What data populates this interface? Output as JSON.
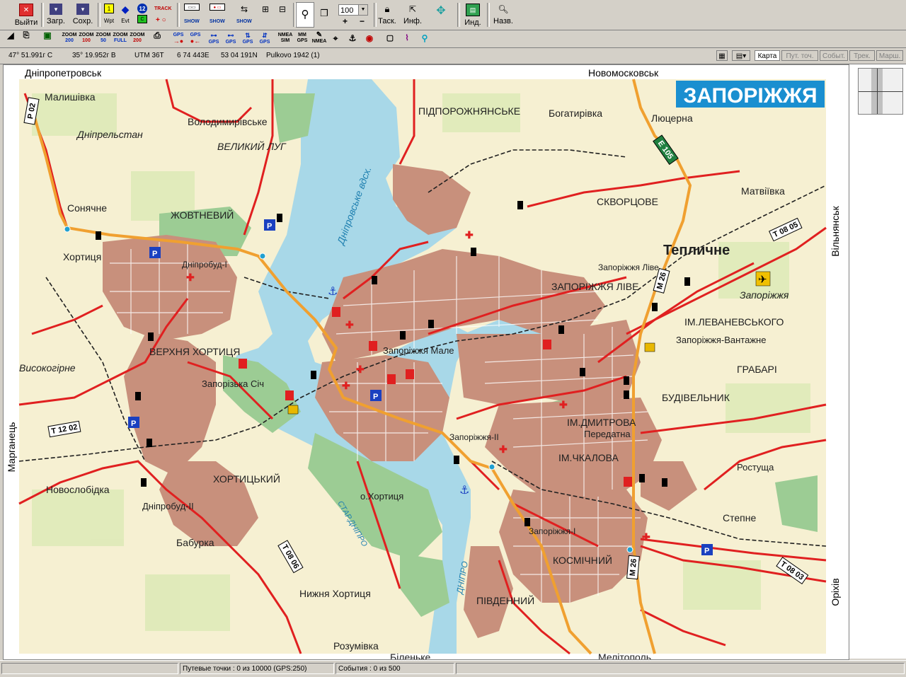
{
  "toolbar": {
    "exit": "Выйти",
    "load": "Загр.",
    "save": "Сохр.",
    "wpt": "Wpt",
    "evt": "Evt",
    "track": "TRACK",
    "show": "SHOW",
    "zoom_value": "100",
    "drag": "Таск.",
    "info": "Инф.",
    "ind": "Инд.",
    "name": "Назв."
  },
  "toolbar2": {
    "zoom200": [
      "ZOOM",
      "200"
    ],
    "zoom100": [
      "ZOOM",
      "100"
    ],
    "zoom50": [
      "ZOOM",
      "50"
    ],
    "zoomfull": [
      "ZOOM",
      "FULL"
    ],
    "zoomcustom": [
      "ZOOM",
      "200"
    ],
    "gps": "GPS",
    "nmea_sim": [
      "NMEA",
      "SIM"
    ],
    "mm": [
      "MM",
      "GPS"
    ],
    "nmea": "NMEA"
  },
  "coords": {
    "lat": "47° 51.991г С",
    "lon": "35° 19.952г В",
    "utm": "UTM  36T",
    "easting": "6 74 443E",
    "northing": "53 04 191N",
    "datum": "Pulkovo 1942 (1)"
  },
  "tabs": [
    "Карта",
    "Пут. точ.",
    "Событ.",
    "Трек.",
    "Марш."
  ],
  "status": {
    "waypoints": "Путевые точки : 0 из 10000  (GPS:250)",
    "events": "События : 0 из 500"
  },
  "map": {
    "title": "ЗАПОРІЖЖЯ",
    "labels": {
      "dnipropetrovsk": "Дніпропетровськ",
      "novomoskovsk": "Новомосковськ",
      "vilniansk": "Вільнянськ",
      "marganets": "Марганець",
      "orikhiv": "Оріхів",
      "malyshivka": "Малишівка",
      "dniprelstan": "Дніпрельстан",
      "volodymyrivske": "Володимирівське",
      "velykyi_luh": "ВЕЛИКИЙ ЛУГ",
      "pidporizhnianske": "ПІДПОРОЖНЯНСЬКЕ",
      "bohatyrivka": "Богатирівка",
      "liutserna": "Люцерна",
      "sonyachne": "Сонячне",
      "zhovtnevyi": "ЖОВТНЕВИЙ",
      "khortytsia": "Хортиця",
      "dniprobud1": "Дніпробуд-І",
      "skvortsove": "СКВОРЦОВЕ",
      "matviivka": "Матвіївка",
      "teplychne": "Тепличне",
      "zap_live": "ЗАПОРІЖЖЯ ЛІВЕ",
      "zap_live2": "Запоріжжя Ліве",
      "zaporizhzhia_airport": "Запоріжжя",
      "levanevsky": "ІМ.ЛЕВАНЕВСЬКОГО",
      "vantazhne": "Запоріжжя-Вантажне",
      "hrabari": "ГРАБАРІ",
      "verkhnia_khortytsia": "ВЕРХНЯ ХОРТИЦЯ",
      "vysokohirne": "Високогірне",
      "zap_male": "Запоріжжя Мале",
      "zap_sich": "Запорізька Січ",
      "budivelnyk": "БУДІВЕЛЬНИК",
      "dmytrova": "ІМ.ДМИТРОВА",
      "peredatna": "Передатна",
      "zap2": "Запоріжжя-ІІ",
      "chkalova": "ІМ.ЧКАЛОВА",
      "rostusha": "Ростуща",
      "khortytskyi": "ХОРТИЦЬКИЙ",
      "novoslobidka": "Новослобідка",
      "dniprobud2": "Дніпробуд-ІІ",
      "o_khortytsia": "о.Хортиця",
      "stepne": "Степне",
      "zap1": "Запоріжжя-І",
      "babutka": "Бабурка",
      "kosmichnyi": "КОСМІЧНИЙ",
      "nyzhnia_khortytsia": "Нижня Хортиця",
      "pivdennyi": "ПІВДЕННИЙ",
      "rozumivka": "Розумівка",
      "bilenke": "Біленьке",
      "melitopol": "Мелітополь",
      "dniprovske_vdskh": "Дніпровське вдсх.",
      "star_dnipro": "СТАР.ДНІПРО",
      "dnipro": "ДНІПРО"
    },
    "road_codes": {
      "p02": "Р 02",
      "e105": "Е 105",
      "m26a": "М 26",
      "m26b": "М 26",
      "t0805": "Т 08 05",
      "t1202": "Т 12 02",
      "t0806": "Т 08 06",
      "t0803": "Т 08 03"
    },
    "colors": {
      "urban": "#c8907c",
      "water": "#a8d8e8",
      "green": "#9ccc94",
      "land": "#f6f0d2",
      "road_main": "#e02020",
      "road_highway": "#f0a030",
      "title_bg": "#1a8fd0"
    }
  }
}
